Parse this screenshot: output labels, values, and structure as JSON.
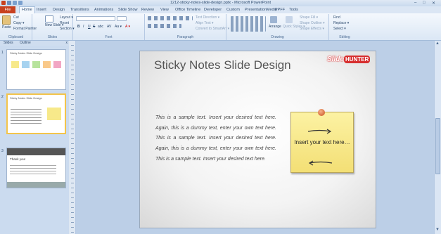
{
  "window": {
    "title": "1212-sticky-notes-slide-design.pptx - Microsoft PowerPoint",
    "minimize": "–",
    "maximize": "□",
    "close": "✕"
  },
  "ribbon_tabs": {
    "file": "File",
    "items": [
      "Home",
      "Insert",
      "Design",
      "Transitions",
      "Animations",
      "Slide Show",
      "Review",
      "View",
      "Office Timeline",
      "Developer",
      "Custom",
      "PresentationMedia",
      "PPFF",
      "Tools"
    ]
  },
  "ribbon": {
    "clipboard": {
      "paste": "Paste",
      "cut": "Cut",
      "copy": "Copy ▾",
      "format_painter": "Format Painter",
      "label": "Clipboard"
    },
    "slides": {
      "new_slide": "New Slide ▾",
      "layout": "Layout ▾",
      "reset": "Reset",
      "section": "Section ▾",
      "label": "Slides"
    },
    "font": {
      "label": "Font",
      "bold": "B",
      "italic": "I",
      "underline": "U",
      "strike": "S",
      "shadow": "abc",
      "spacing": "AV",
      "case": "Aa ▾",
      "font_color": "A ▾"
    },
    "paragraph": {
      "label": "Paragraph",
      "text_direction": "Text Direction ▾",
      "align_text": "Align Text ▾",
      "smartart": "Convert to SmartArt ▾"
    },
    "drawing": {
      "label": "Drawing",
      "arrange": "Arrange",
      "quick_styles": "Quick Styles ▾",
      "shape_fill": "Shape Fill ▾",
      "shape_outline": "Shape Outline ▾",
      "shape_effects": "Shape Effects ▾"
    },
    "editing": {
      "label": "Editing",
      "find": "Find",
      "replace": "Replace ▾",
      "select": "Select ▾"
    }
  },
  "pane": {
    "tab_slides": "Slides",
    "tab_outline": "Outline",
    "close": "x",
    "thumbnails": [
      {
        "num": "1",
        "title": "Sticky Notes Slide Design"
      },
      {
        "num": "2",
        "title": "Sticky Notes Slide Design"
      },
      {
        "num": "3",
        "title": "Thank you!"
      }
    ]
  },
  "slide": {
    "title": "Sticky Notes Slide Design",
    "logo_slide": "Slide",
    "logo_hunter": "HUNTER",
    "body": "This is a sample text. Insert your desired text here. Again, this is a dummy text, enter your own text here. This is a sample text. Insert your desired text here. Again, this is a dummy text, enter your own text here. This is a sample text. Insert your desired text here.",
    "note_text": "Insert your text here…"
  },
  "scrollbar": {
    "up": "▲",
    "down": "▼"
  },
  "colors": {
    "file_tab": "#c8401f",
    "note": "#f7e98a",
    "accent_selected": "#f3c44a",
    "logo_red": "#d72f2f"
  }
}
